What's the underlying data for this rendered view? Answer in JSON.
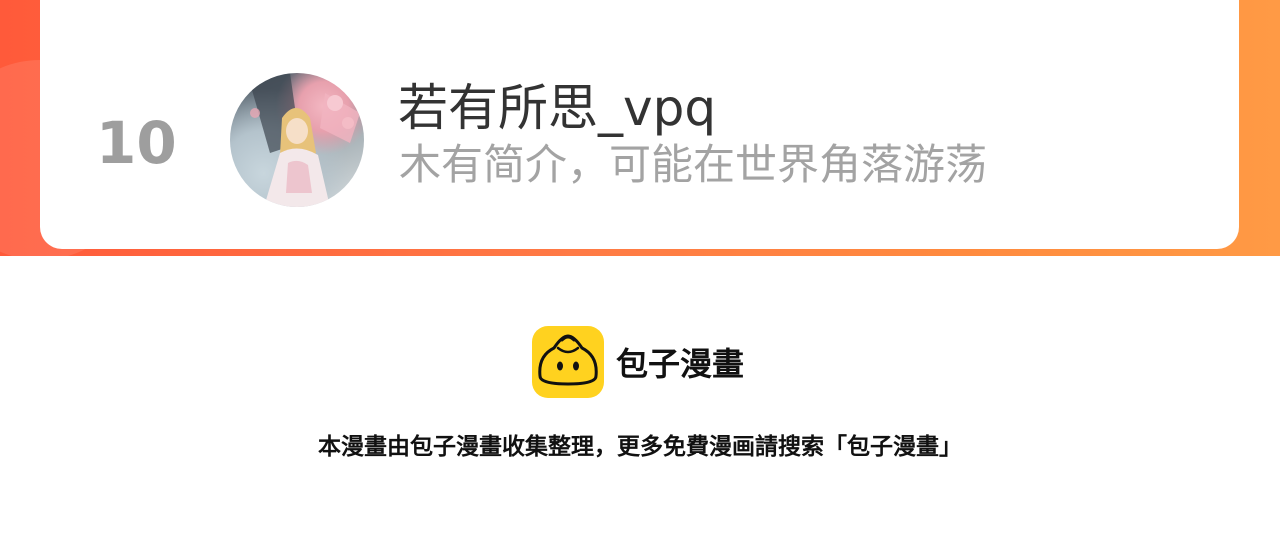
{
  "ranking_entry": {
    "rank": "10",
    "username": "若有所思_vpq",
    "bio": "木有简介，可能在世界角落游荡"
  },
  "branding": {
    "logo_icon": "baozi-bun-icon",
    "name": "包子漫畫",
    "notice": "本漫畫由包子漫畫收集整理，更多免費漫画請搜索「包子漫畫」"
  },
  "colors": {
    "banner_gradient_start": "#ff5a3a",
    "banner_gradient_end": "#ff9a45",
    "card": "#ffffff",
    "rank_text": "#9e9e9e",
    "username_text": "#333333",
    "bio_text": "#a3a3a3",
    "logo_background": "#ffd21f"
  }
}
